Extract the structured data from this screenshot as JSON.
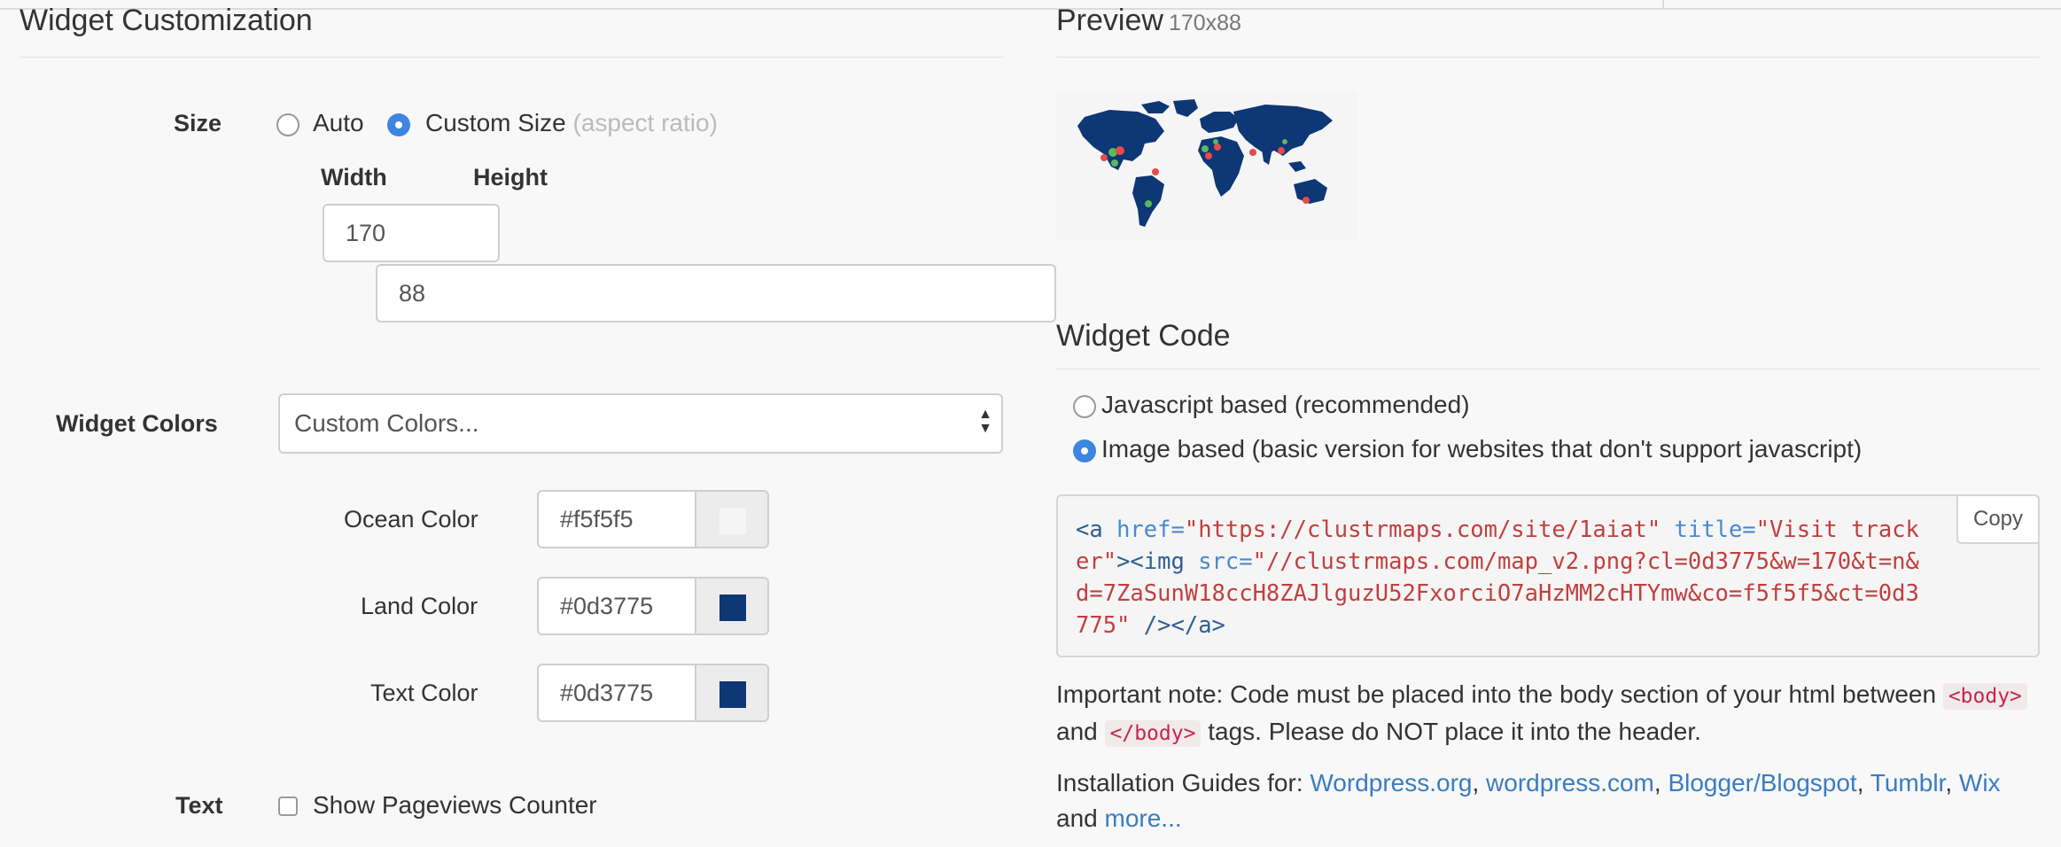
{
  "left": {
    "title": "Widget Customization",
    "size": {
      "label": "Size",
      "auto_label": "Auto",
      "custom_label": "Custom Size",
      "custom_hint": "(aspect ratio)",
      "width_label": "Width",
      "height_label": "Height",
      "width_value": "170",
      "height_value": "88"
    },
    "colors": {
      "label": "Widget Colors",
      "selected": "Custom Colors...",
      "rows": [
        {
          "label": "Ocean Color",
          "value": "#f5f5f5",
          "swatch": "#f5f5f5"
        },
        {
          "label": "Land Color",
          "value": "#0d3775",
          "swatch": "#0d3775"
        },
        {
          "label": "Text Color",
          "value": "#0d3775",
          "swatch": "#0d3775"
        }
      ]
    },
    "text": {
      "label": "Text",
      "pageviews_label": "Show Pageviews Counter"
    }
  },
  "right": {
    "preview_title": "Preview",
    "preview_size": "170x88",
    "code_title": "Widget Code",
    "options": [
      {
        "label": "Javascript based (recommended)",
        "checked": false
      },
      {
        "label": "Image based (basic version for websites that don't support javascript)",
        "checked": true
      }
    ],
    "copy_label": "Copy",
    "code": {
      "open_a": "<a",
      "href_attr": "href=",
      "href_val": "\"https://clustrmaps.com/site/1aiat\"",
      "title_attr": "title=",
      "title_val": "\"Visit tracker\"",
      "img_tag": "><img",
      "src_attr": "src=",
      "src_val": "\"//clustrmaps.com/map_v2.png?cl=0d3775&w=170&t=n&d=7ZaSunW18ccH8ZAJlguzU52FxorciO7aHzMM2cHTYmw&co=f5f5f5&ct=0d3775\"",
      "close": "/></a>"
    },
    "note_text_1": "Important note: Code must be placed into the body section of your html between",
    "note_body_open": "<body>",
    "note_and": "and",
    "note_body_close": "</body>",
    "note_text_2": "tags. Please do NOT place it into the header.",
    "guides_label": "Installation Guides for:",
    "guides": [
      "Wordpress.org",
      "wordpress.com",
      "Blogger/Blogspot",
      "Tumblr",
      "Wix"
    ],
    "and_label": "and",
    "more_label": "more..."
  },
  "colors": {
    "accent": "#3d85e0",
    "link": "#3a7cc1",
    "land": "#0d3775",
    "ocean": "#f5f5f5",
    "marker_red": "#e8494a",
    "marker_green": "#5cb85c"
  }
}
